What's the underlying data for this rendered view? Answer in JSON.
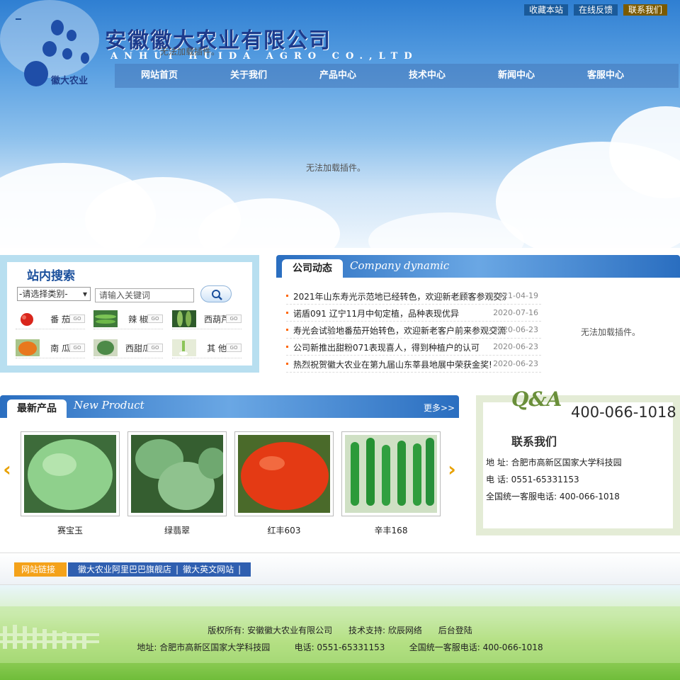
{
  "top_links": [
    "收藏本站",
    "在线反馈",
    "联系我们"
  ],
  "logo_text": "徽大农业",
  "company_cn": "安徽徽大农业有限公司",
  "company_en": "ANHUI HUIDA AGRO CO.,LTD",
  "plugin_notice": "无法加载插件。",
  "nav": [
    "网站首页",
    "关于我们",
    "产品中心",
    "技术中心",
    "新闻中心",
    "客服中心"
  ],
  "search": {
    "title": "站内搜索",
    "select_value": "-请选择类别-",
    "placeholder": "请输入关键词",
    "go_label": "GO",
    "categories": [
      "番 茄",
      "辣 椒",
      "西葫芦",
      "南 瓜",
      "西甜瓜",
      "其 他"
    ]
  },
  "news": {
    "title": "公司动态",
    "title_en": "Company dynamic",
    "items": [
      {
        "text": "2021年山东寿光示范地已经转色，欢迎新老顾客参观交流",
        "date": "2021-04-19"
      },
      {
        "text": "诺盾091 辽宁11月中旬定植，品种表现优异",
        "date": "2020-07-16"
      },
      {
        "text": "寿光会试验地番茄开始转色，欢迎新老客户前来参观交流",
        "date": "2020-06-23"
      },
      {
        "text": "公司新推出甜粉071表现喜人，得到种植户的认可",
        "date": "2020-06-23"
      },
      {
        "text": "热烈祝贺徽大农业在第九届山东莘县地展中荣获金奖!",
        "date": "2020-06-23"
      }
    ]
  },
  "products": {
    "title": "最新产品",
    "title_en": "New Product",
    "more": "更多>>",
    "items": [
      {
        "name": "赛宝玉",
        "color": "#7cc27a"
      },
      {
        "name": "绿翡翠",
        "color": "#6daa74"
      },
      {
        "name": "红丰603",
        "color": "#e0401e"
      },
      {
        "name": "辛丰168",
        "color": "#2f9a3c"
      }
    ]
  },
  "contact": {
    "badge": "Q&A",
    "phone": "400-066-1018",
    "title": "联系我们",
    "address": "地 址: 合肥市高新区国家大学科技园",
    "tel": "电 话: 0551-65331153",
    "hotline": "全国统一客服电话: 400-066-1018"
  },
  "links": {
    "label": "网站链接",
    "items": [
      "徽大农业阿里巴巴旗舰店",
      "|",
      "徽大英文网站",
      "|"
    ]
  },
  "footer": {
    "line1": "版权所有: 安徽徽大农业有限公司      技术支持: 欣辰网络      后台登陆",
    "line2": "地址: 合肥市高新区国家大学科技园         电话: 0551-65331153         全国统一客服电话: 400-066-1018"
  }
}
